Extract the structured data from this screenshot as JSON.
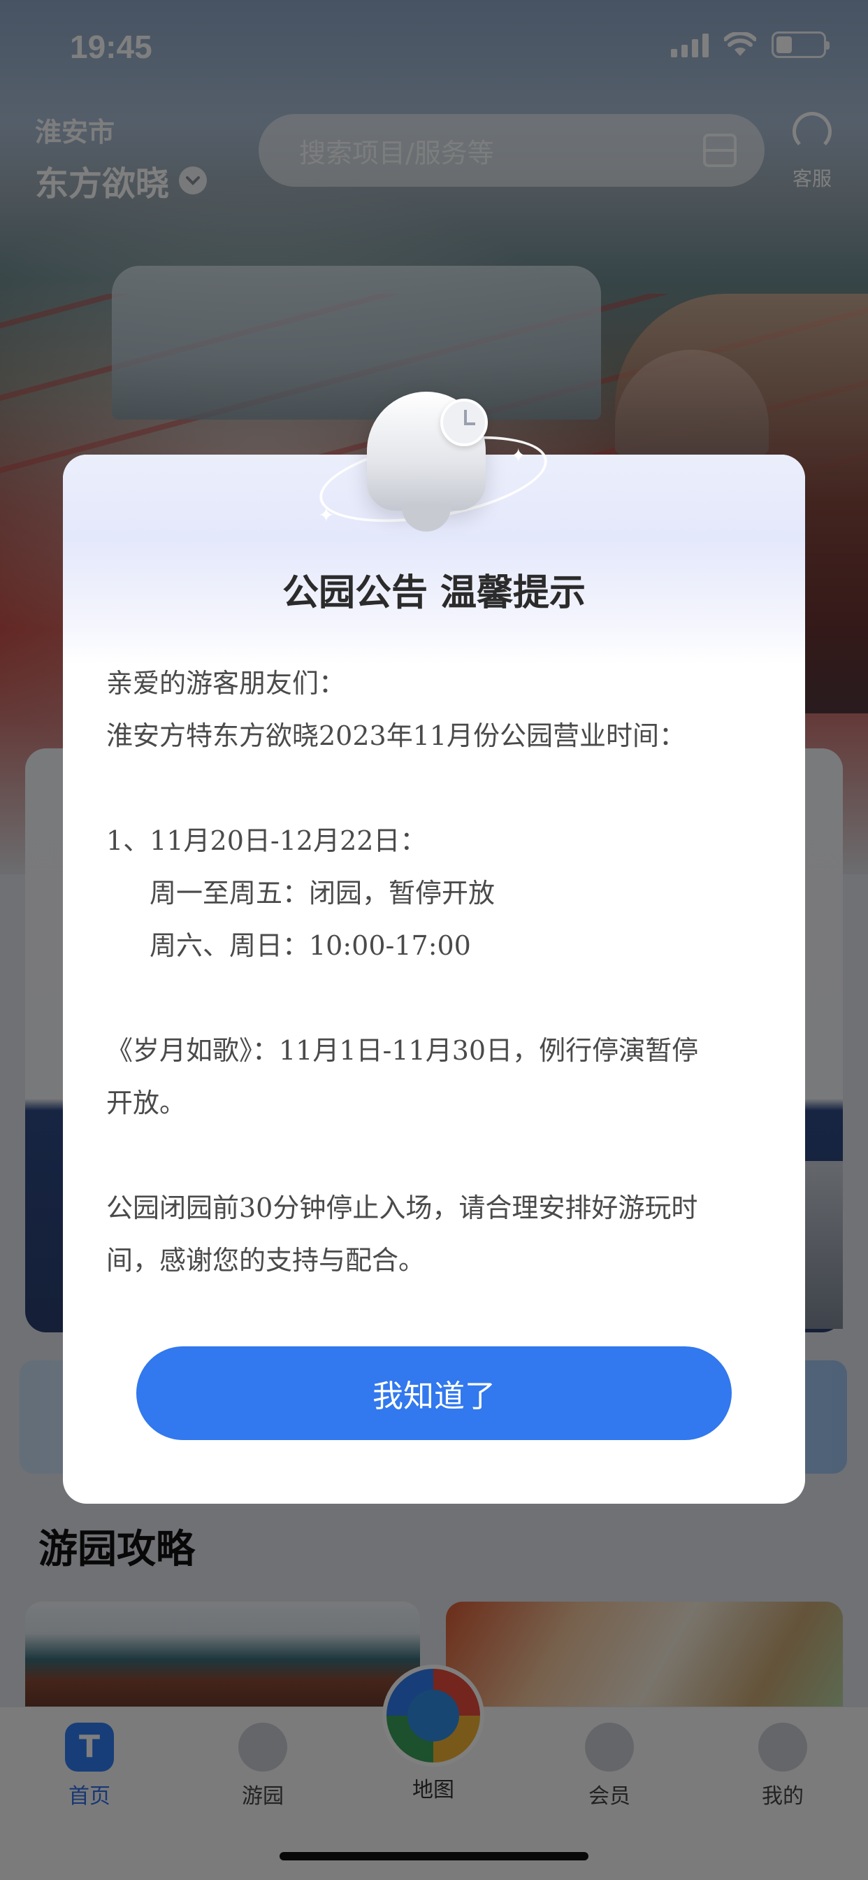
{
  "status_bar": {
    "time": "19:45",
    "icons": [
      "signal-icon",
      "wifi-icon",
      "battery-icon"
    ]
  },
  "header": {
    "city": "淮安市",
    "park": "东方欲晓",
    "search_placeholder": "搜索项目/服务等",
    "service_label": "客服"
  },
  "section": {
    "guide_title": "游园攻略"
  },
  "tabbar": {
    "items": [
      {
        "label": "首页",
        "icon": "home-icon",
        "active": true
      },
      {
        "label": "游园",
        "icon": "navigate-icon",
        "active": false
      },
      {
        "label": "地图",
        "icon": "map-icon",
        "active": false
      },
      {
        "label": "会员",
        "icon": "crown-icon",
        "active": false
      },
      {
        "label": "我的",
        "icon": "profile-icon",
        "active": false
      }
    ]
  },
  "modal": {
    "title": "公园公告 温馨提示",
    "lines": [
      "亲爱的游客朋友们：",
      "淮安方特东方欲晓2023年11月份公园营业时间：",
      "1、11月20日-12月22日：",
      "周一至周五：闭园，暂停开放",
      "周六、周日：10:00-17:00",
      "《岁月如歌》：11月1日-11月30日，例行停演暂停",
      "开放。",
      "公园闭园前30分钟停止入场，请合理安排好游玩时",
      "间，感谢您的支持与配合。"
    ],
    "confirm_label": "我知道了"
  },
  "colors": {
    "accent": "#3278ee",
    "tab_active": "#2f6fe6",
    "overlay": "rgba(0,0,0,0.5)"
  }
}
